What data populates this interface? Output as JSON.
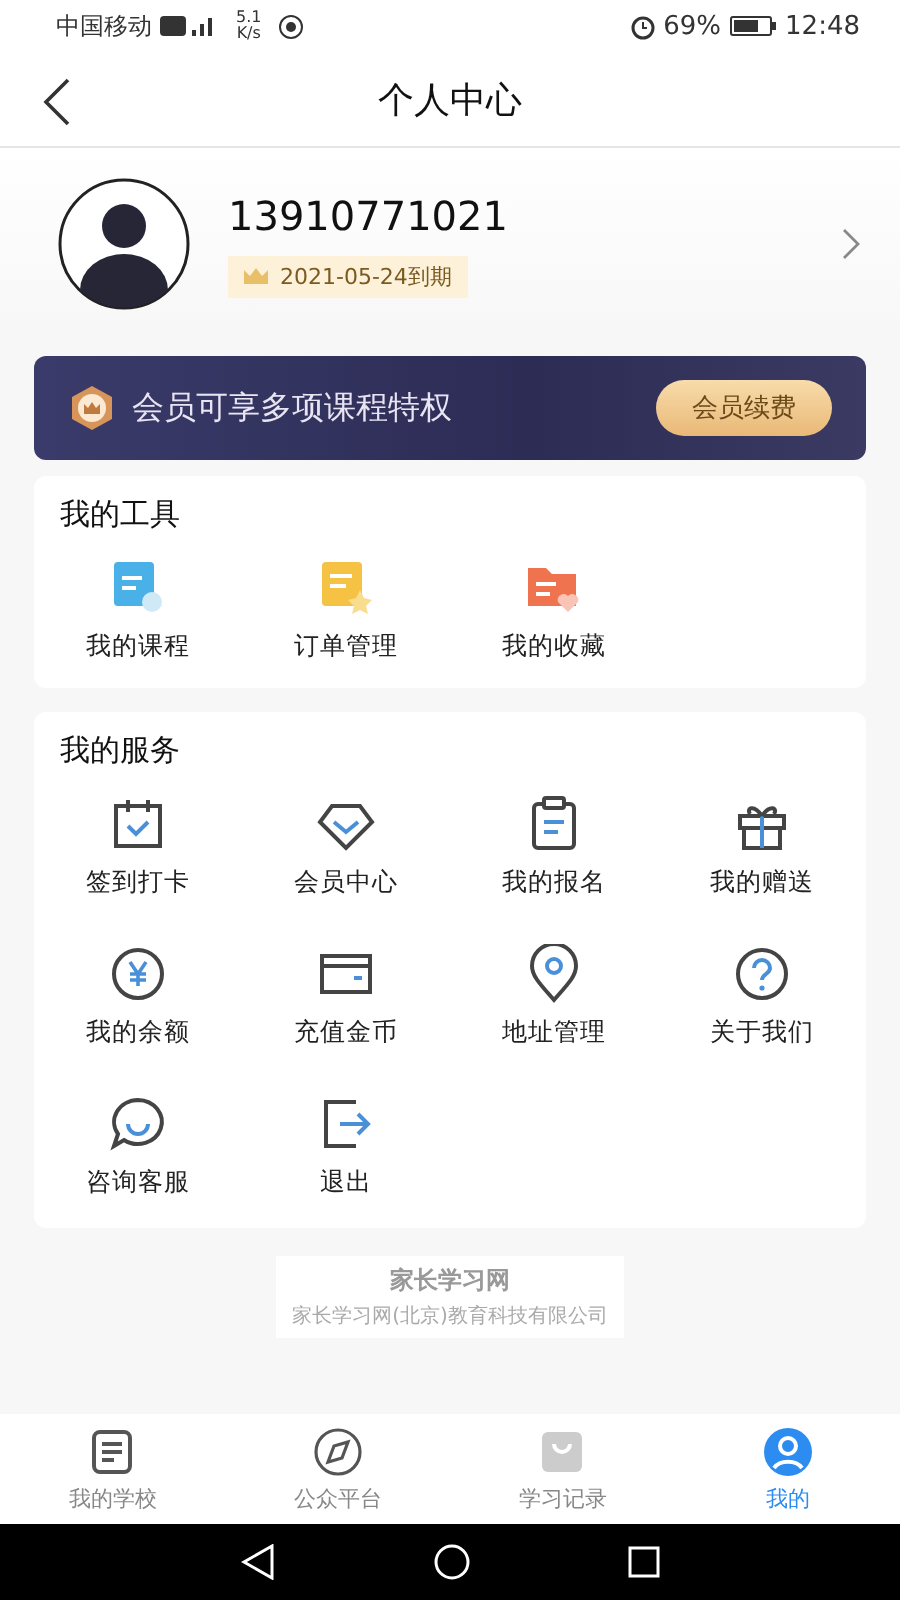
{
  "status_bar": {
    "carrier": "中国移动",
    "speed_value": "5.1",
    "speed_unit": "K/s",
    "battery": "69%",
    "time": "12:48"
  },
  "header": {
    "title": "个人中心"
  },
  "profile": {
    "phone": "13910771021",
    "expiry": "2021-05-24到期"
  },
  "banner": {
    "text": "会员可享多项课程特权",
    "button": "会员续费"
  },
  "tools": {
    "title": "我的工具",
    "items": [
      {
        "label": "我的课程",
        "kind": "course"
      },
      {
        "label": "订单管理",
        "kind": "order"
      },
      {
        "label": "我的收藏",
        "kind": "favorite"
      }
    ]
  },
  "services": {
    "title": "我的服务",
    "items": [
      {
        "label": "签到打卡",
        "kind": "calendar"
      },
      {
        "label": "会员中心",
        "kind": "diamond"
      },
      {
        "label": "我的报名",
        "kind": "clipboard"
      },
      {
        "label": "我的赠送",
        "kind": "gift"
      },
      {
        "label": "我的余额",
        "kind": "yen"
      },
      {
        "label": "充值金币",
        "kind": "card"
      },
      {
        "label": "地址管理",
        "kind": "pin"
      },
      {
        "label": "关于我们",
        "kind": "question"
      },
      {
        "label": "咨询客服",
        "kind": "chat"
      },
      {
        "label": "退出",
        "kind": "exit"
      }
    ]
  },
  "footer": {
    "name": "家长学习网",
    "company": "家长学习网(北京)教育科技有限公司"
  },
  "tab_bar": [
    {
      "label": "我的学校",
      "kind": "school",
      "selected": false
    },
    {
      "label": "公众平台",
      "kind": "compass",
      "selected": false
    },
    {
      "label": "学习记录",
      "kind": "bag",
      "selected": false
    },
    {
      "label": "我的",
      "kind": "user",
      "selected": true
    }
  ]
}
